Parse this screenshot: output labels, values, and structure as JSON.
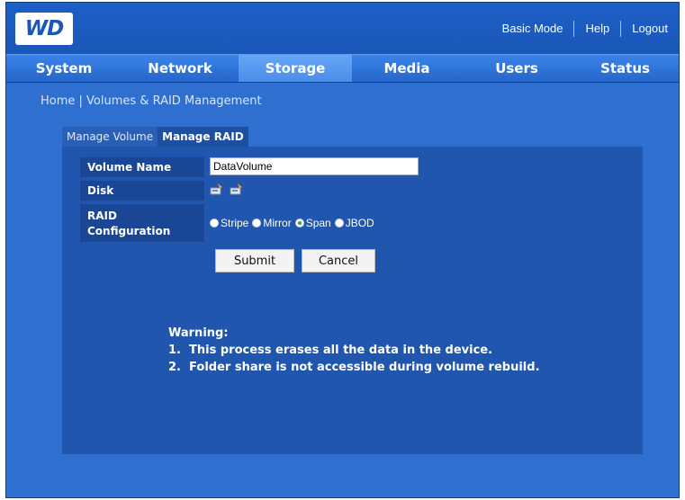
{
  "header": {
    "logo_text": "WD",
    "links": [
      "Basic Mode",
      "Help",
      "Logout"
    ]
  },
  "nav": {
    "tabs": [
      "System",
      "Network",
      "Storage",
      "Media",
      "Users",
      "Status"
    ],
    "active": "Storage"
  },
  "breadcrumb": {
    "home": "Home",
    "separator": " | ",
    "current": "Volumes & RAID Management"
  },
  "subtabs": {
    "manage_volume": "Manage Volume",
    "manage_raid": "Manage RAID"
  },
  "form": {
    "volume_name_label": "Volume Name",
    "volume_name_value": "DataVolume",
    "disk_label": "Disk",
    "disk_icons": [
      "disk-drive-icon",
      "disk-drive-icon"
    ],
    "raid_label_line1": "RAID",
    "raid_label_line2": "Configuration",
    "raid_options": [
      "Stripe",
      "Mirror",
      "Span",
      "JBOD"
    ],
    "raid_selected": "Span",
    "submit_label": "Submit",
    "cancel_label": "Cancel"
  },
  "warning": {
    "title": "Warning:",
    "lines": [
      "1.  This process erases all the data in the device.",
      "2.  Folder share is not accessible during volume rebuild."
    ]
  },
  "colors": {
    "background": "#2f6fcf",
    "panel": "#2056ad",
    "label_cell": "#1a4696",
    "active_tab": "#4a8de9"
  }
}
